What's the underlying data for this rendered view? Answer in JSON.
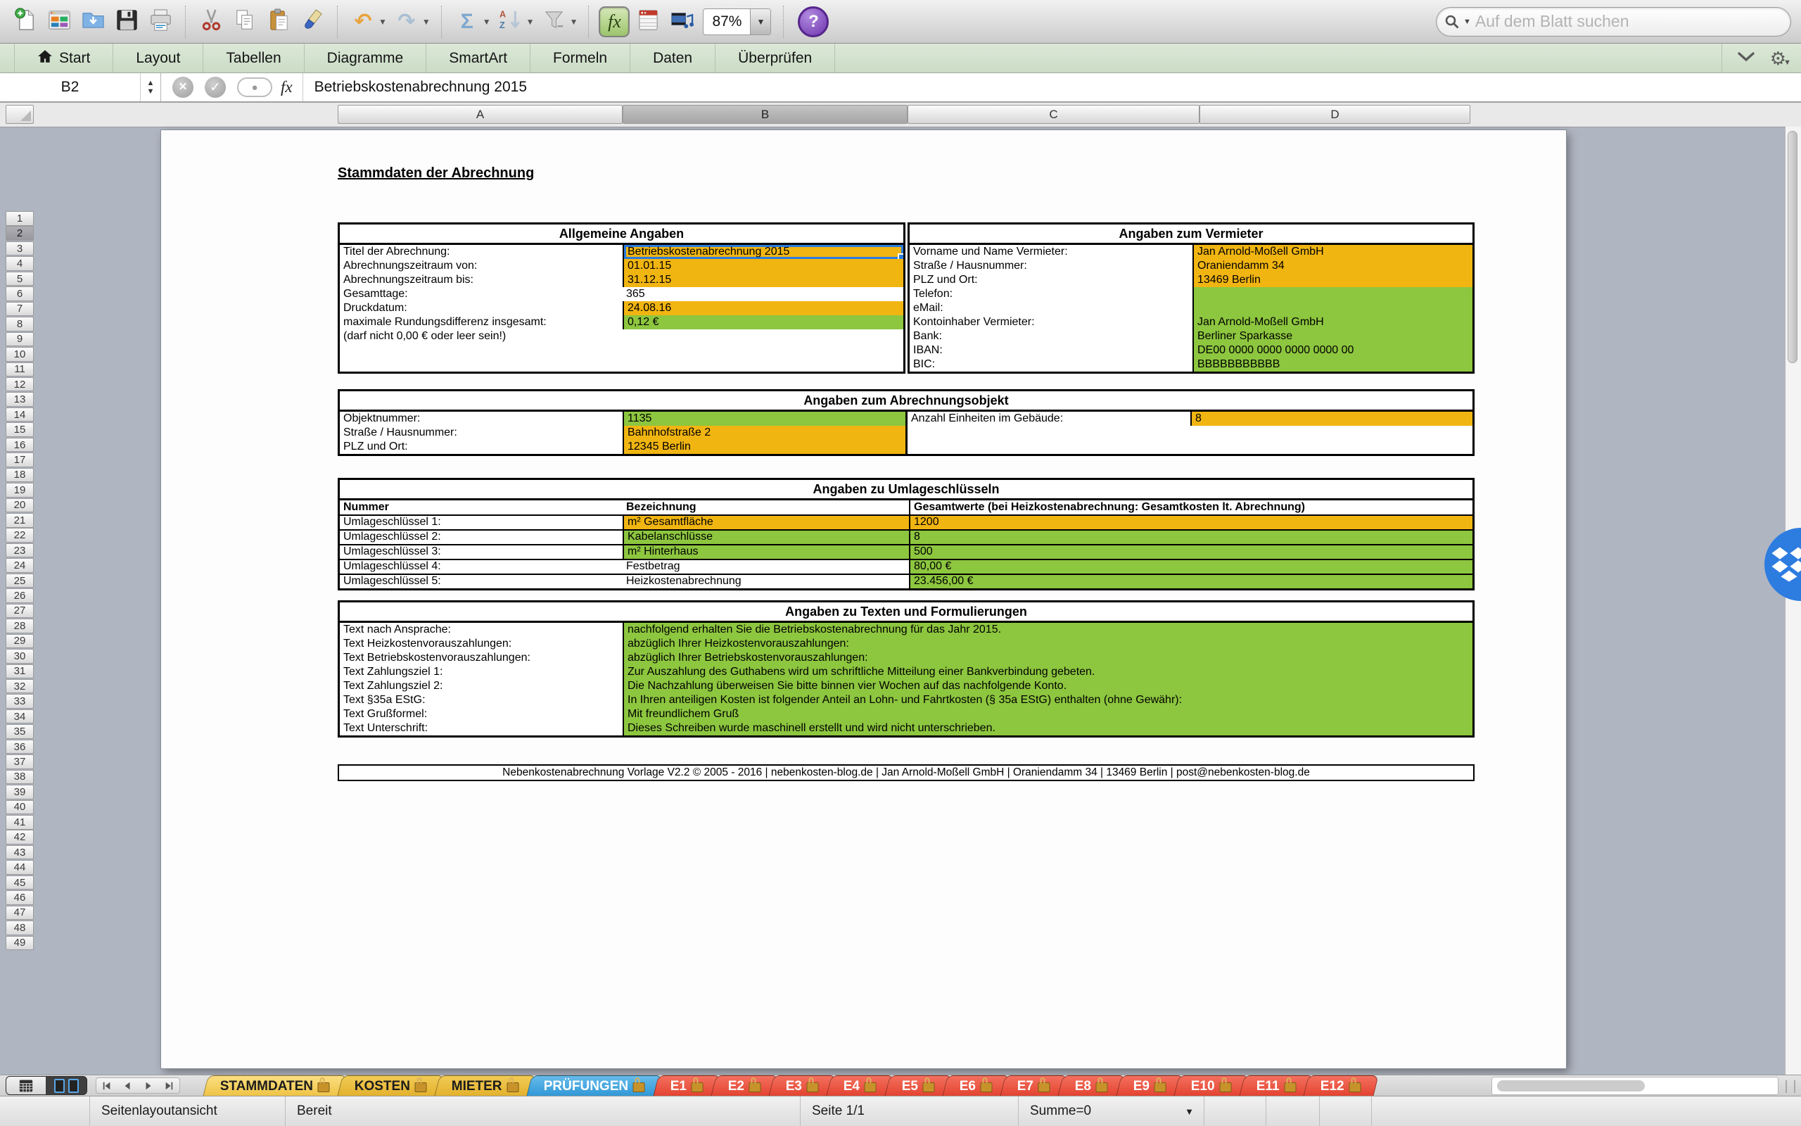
{
  "toolbar": {
    "zoom_value": "87%",
    "search_placeholder": "Auf dem Blatt suchen",
    "buttons": [
      {
        "name": "new-document"
      },
      {
        "name": "open-gallery"
      },
      {
        "name": "open-folder"
      },
      {
        "name": "save"
      },
      {
        "name": "print",
        "sep": true
      },
      {
        "name": "cut"
      },
      {
        "name": "copy"
      },
      {
        "name": "paste"
      },
      {
        "name": "format-painter",
        "sep": true
      },
      {
        "name": "undo",
        "dropdown": true
      },
      {
        "name": "redo",
        "dropdown": true,
        "sep": true
      },
      {
        "name": "autosum",
        "dropdown": true
      },
      {
        "name": "sort-az",
        "dropdown": true
      },
      {
        "name": "filter",
        "dropdown": true,
        "sep": true
      },
      {
        "name": "formula-builder",
        "pressed": true
      },
      {
        "name": "toolbox"
      },
      {
        "name": "media"
      },
      {
        "name": "zoom-control",
        "dropdown": true,
        "sep": true
      },
      {
        "name": "help"
      }
    ]
  },
  "ribbon": {
    "tabs": [
      {
        "label": "Start",
        "icon": "home"
      },
      {
        "label": "Layout"
      },
      {
        "label": "Tabellen"
      },
      {
        "label": "Diagramme"
      },
      {
        "label": "SmartArt"
      },
      {
        "label": "Formeln"
      },
      {
        "label": "Daten"
      },
      {
        "label": "Überprüfen"
      }
    ]
  },
  "formula_bar": {
    "cell_ref": "B2",
    "content": "Betriebskostenabrechnung 2015"
  },
  "grid": {
    "columns": [
      "A",
      "B",
      "C",
      "D"
    ],
    "selected_column": "B",
    "row_start": 1,
    "row_end": 49,
    "selected_row": 2
  },
  "page": {
    "title": "Stammdaten der Abrechnung",
    "allgemein": {
      "title": "Allgemeine Angaben",
      "rows": [
        {
          "label": "Titel der Abrechnung:",
          "value": "Betriebskostenabrechnung 2015",
          "bg": "orange",
          "selected": true
        },
        {
          "label": "Abrechnungszeitraum von:",
          "value": "01.01.15",
          "bg": "orange"
        },
        {
          "label": "Abrechnungszeitraum bis:",
          "value": "31.12.15",
          "bg": "orange"
        },
        {
          "label": "Gesamttage:",
          "value": "365",
          "bg": "white"
        },
        {
          "label": "Druckdatum:",
          "value": "24.08.16",
          "bg": "orange"
        },
        {
          "label": "maximale Rundungsdifferenz insgesamt:",
          "value": "0,12 €",
          "bg": "green"
        },
        {
          "label": "(darf nicht 0,00 € oder leer sein!)",
          "value": "",
          "bg": "none"
        },
        {
          "label": "",
          "value": "",
          "bg": "none"
        },
        {
          "label": "",
          "value": "",
          "bg": "none"
        }
      ]
    },
    "vermieter": {
      "title": "Angaben zum Vermieter",
      "rows": [
        {
          "label": "Vorname und Name Vermieter:",
          "value": "Jan Arnold-Moßell GmbH",
          "bg": "orange"
        },
        {
          "label": "Straße / Hausnummer:",
          "value": "Oraniendamm 34",
          "bg": "orange"
        },
        {
          "label": "PLZ und Ort:",
          "value": "13469 Berlin",
          "bg": "orange"
        },
        {
          "label": "Telefon:",
          "value": "",
          "bg": "green"
        },
        {
          "label": "eMail:",
          "value": "",
          "bg": "green"
        },
        {
          "label": "Kontoinhaber Vermieter:",
          "value": "Jan Arnold-Moßell GmbH",
          "bg": "green"
        },
        {
          "label": "Bank:",
          "value": "Berliner Sparkasse",
          "bg": "green"
        },
        {
          "label": "IBAN:",
          "value": "DE00 0000 0000 0000 0000 00",
          "bg": "green"
        },
        {
          "label": "BIC:",
          "value": "BBBBBBBBBBB",
          "bg": "green"
        }
      ]
    },
    "objekt": {
      "title": "Angaben zum Abrechnungsobjekt",
      "left_rows": [
        {
          "label": "Objektnummer:",
          "value": "1135",
          "bg": "green"
        },
        {
          "label": "Straße / Hausnummer:",
          "value": "Bahnhofstraße 2",
          "bg": "orange"
        },
        {
          "label": "PLZ und Ort:",
          "value": "12345 Berlin",
          "bg": "orange"
        }
      ],
      "right_rows": [
        {
          "label": "Anzahl Einheiten im Gebäude:",
          "value": "8",
          "bg": "orange"
        },
        {
          "label": "",
          "value": "",
          "bg": "none"
        },
        {
          "label": "",
          "value": "",
          "bg": "none"
        }
      ]
    },
    "umlage": {
      "title": "Angaben zu Umlageschlüsseln",
      "col_headers": [
        "Nummer",
        "Bezeichnung",
        "Gesamtwerte (bei Heizkostenabrechnung: Gesamtkosten lt. Abrechnung)"
      ],
      "rows": [
        {
          "nummer": "Umlageschlüssel 1:",
          "bezeichnung": "m² Gesamtfläche",
          "bez_bg": "orange",
          "wert": "1200",
          "wert_bg": "orange"
        },
        {
          "nummer": "Umlageschlüssel 2:",
          "bezeichnung": "Kabelanschlüsse",
          "bez_bg": "green",
          "wert": "8",
          "wert_bg": "green"
        },
        {
          "nummer": "Umlageschlüssel 3:",
          "bezeichnung": "m² Hinterhaus",
          "bez_bg": "green",
          "wert": "500",
          "wert_bg": "green"
        },
        {
          "nummer": "Umlageschlüssel 4:",
          "bezeichnung": "Festbetrag",
          "bez_bg": "white",
          "wert": "80,00 €",
          "wert_bg": "green"
        },
        {
          "nummer": "Umlageschlüssel 5:",
          "bezeichnung": "Heizkostenabrechnung",
          "bez_bg": "white",
          "wert": "23.456,00 €",
          "wert_bg": "green"
        }
      ]
    },
    "texte": {
      "title": "Angaben zu Texten und Formulierungen",
      "rows": [
        {
          "label": "Text nach Ansprache:",
          "value": "nachfolgend erhalten Sie die Betriebskostenabrechnung für das Jahr 2015."
        },
        {
          "label": "Text Heizkostenvorauszahlungen:",
          "value": "abzüglich Ihrer Heizkostenvorauszahlungen:"
        },
        {
          "label": "Text Betriebskostenvorauszahlungen:",
          "value": "abzüglich Ihrer Betriebskostenvorauszahlungen:"
        },
        {
          "label": "Text Zahlungsziel 1:",
          "value": "Zur Auszahlung des Guthabens wird um schriftliche Mitteilung einer Bankverbindung gebeten."
        },
        {
          "label": "Text Zahlungsziel 2:",
          "value": "Die Nachzahlung überweisen Sie bitte binnen vier Wochen auf das nachfolgende Konto."
        },
        {
          "label": "Text §35a EStG:",
          "value": "In Ihren anteiligen Kosten ist folgender Anteil an Lohn- und Fahrtkosten (§ 35a EStG) enthalten (ohne Gewähr):"
        },
        {
          "label": "Text Grußformel:",
          "value": "Mit freundlichem Gruß"
        },
        {
          "label": "Text Unterschrift:",
          "value": "Dieses Schreiben wurde maschinell erstellt und wird nicht unterschrieben."
        }
      ]
    },
    "footer": "Nebenkostenabrechnung Vorlage V2.2 © 2005 - 2016 | nebenkosten-blog.de | Jan Arnold-Moßell GmbH | Oraniendamm 34 | 13469 Berlin | post@nebenkosten-blog.de"
  },
  "sheet_tabs": [
    {
      "label": "STAMMDATEN",
      "color": "gold",
      "active": true,
      "locked": true
    },
    {
      "label": "KOSTEN",
      "color": "gold",
      "locked": true
    },
    {
      "label": "MIETER",
      "color": "gold",
      "locked": true
    },
    {
      "label": "PRÜFUNGEN",
      "color": "blue",
      "locked": true
    },
    {
      "label": "E1",
      "color": "red",
      "locked": true
    },
    {
      "label": "E2",
      "color": "red",
      "locked": true
    },
    {
      "label": "E3",
      "color": "red",
      "locked": true
    },
    {
      "label": "E4",
      "color": "red",
      "locked": true
    },
    {
      "label": "E5",
      "color": "red",
      "locked": true
    },
    {
      "label": "E6",
      "color": "red",
      "locked": true
    },
    {
      "label": "E7",
      "color": "red",
      "locked": true
    },
    {
      "label": "E8",
      "color": "red",
      "locked": true
    },
    {
      "label": "E9",
      "color": "red",
      "locked": true
    },
    {
      "label": "E10",
      "color": "red",
      "locked": true
    },
    {
      "label": "E11",
      "color": "red",
      "locked": true
    },
    {
      "label": "E12",
      "color": "red",
      "locked": true
    }
  ],
  "status_bar": {
    "view_mode": "Seitenlayoutansicht",
    "state": "Bereit",
    "page": "Seite 1/1",
    "sum": "Summe=0"
  },
  "colors": {
    "cell_orange": "#F1B512",
    "cell_green": "#8DC63F",
    "tab_gold": "#E8BE3E",
    "tab_blue": "#3FA0DB",
    "tab_red": "#EA5440",
    "selection_blue": "#2B7CDE",
    "ribbon_green": "#D3E1CF"
  }
}
